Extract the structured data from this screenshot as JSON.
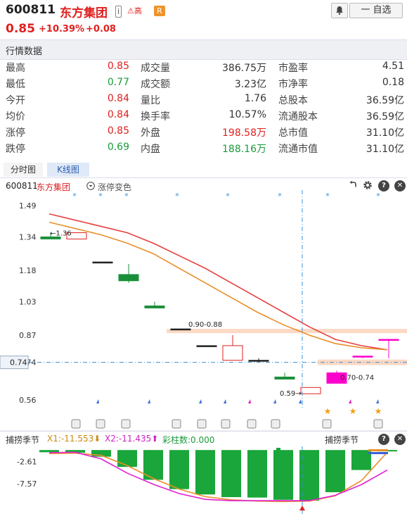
{
  "header": {
    "code": "600811",
    "name": "东方集团",
    "tag_info": "i",
    "tag_risk": "⚠高",
    "tag_r": "R",
    "price": "0.85",
    "change_pct": "+10.39%",
    "change": "+0.08",
    "bell_icon": "bell-icon",
    "watch_label": "一 自选"
  },
  "quote_section": {
    "title": "行情数据",
    "rows": [
      {
        "l1": "最高",
        "v1": "0.85",
        "l2": "成交量",
        "v2": "386.75万",
        "l3": "市盈率",
        "v3": "4.51"
      },
      {
        "l1": "最低",
        "v1": "0.77",
        "l2": "成交额",
        "v2": "3.23亿",
        "l3": "市净率",
        "v3": "0.18"
      },
      {
        "l1": "今开",
        "v1": "0.84",
        "l2": "量比",
        "v2": "1.76",
        "l3": "总股本",
        "v3": "36.59亿"
      },
      {
        "l1": "均价",
        "v1": "0.84",
        "l2": "换手率",
        "v2": "10.57%",
        "l3": "流通股本",
        "v3": "36.59亿"
      },
      {
        "l1": "涨停",
        "v1": "0.85",
        "l2": "外盘",
        "v2": "198.58万",
        "l3": "总市值",
        "v3": "31.10亿"
      },
      {
        "l1": "跌停",
        "v1": "0.69",
        "l2": "内盘",
        "v2": "188.16万",
        "l3": "流通市值",
        "v3": "31.10亿"
      }
    ]
  },
  "tabs": {
    "timeshare": "分时图",
    "kline": "K线图"
  },
  "kline_bar": {
    "code": "600811",
    "name": "东方集团",
    "mode": "涨停变色"
  },
  "chart_data": [
    {
      "type": "candlestick",
      "y_ticks": [
        "1.49",
        "1.34",
        "1.18",
        "1.03",
        "0.87",
        "0.74",
        "0.56"
      ],
      "ylim": [
        0.52,
        1.53
      ],
      "candles": [
        {
          "open": 1.34,
          "close": 1.33,
          "high": 1.36,
          "low": 1.33,
          "color": "green"
        },
        {
          "open": 1.33,
          "close": 1.36,
          "high": 1.36,
          "low": 1.33,
          "color": "red"
        },
        {
          "open": 1.22,
          "close": 1.22,
          "high": 1.22,
          "low": 1.22,
          "color": "black"
        },
        {
          "open": 1.16,
          "close": 1.13,
          "high": 1.21,
          "low": 1.12,
          "color": "green"
        },
        {
          "open": 1.01,
          "close": 1.0,
          "high": 1.03,
          "low": 1.0,
          "color": "green"
        },
        {
          "open": 0.9,
          "close": 0.9,
          "high": 0.9,
          "low": 0.9,
          "color": "black"
        },
        {
          "open": 0.82,
          "close": 0.82,
          "high": 0.82,
          "low": 0.82,
          "color": "black"
        },
        {
          "open": 0.75,
          "close": 0.82,
          "high": 0.87,
          "low": 0.75,
          "color": "red"
        },
        {
          "open": 0.75,
          "close": 0.75,
          "high": 0.76,
          "low": 0.74,
          "color": "black"
        },
        {
          "open": 0.67,
          "close": 0.66,
          "high": 0.69,
          "low": 0.66,
          "color": "green"
        },
        {
          "open": 0.59,
          "close": 0.62,
          "high": 0.62,
          "low": 0.59,
          "color": "red"
        },
        {
          "open": 0.64,
          "close": 0.69,
          "high": 0.7,
          "low": 0.64,
          "color": "magenta"
        },
        {
          "open": 0.77,
          "close": 0.77,
          "high": 0.77,
          "low": 0.76,
          "color": "magenta"
        },
        {
          "open": 0.85,
          "close": 0.85,
          "high": 0.85,
          "low": 0.76,
          "color": "magenta"
        }
      ],
      "ma_red": [
        1.45,
        1.42,
        1.39,
        1.36,
        1.31,
        1.25,
        1.19,
        1.12,
        1.05,
        0.98,
        0.91,
        0.85,
        0.82,
        0.8
      ],
      "ma_orange": [
        1.41,
        1.38,
        1.35,
        1.31,
        1.26,
        1.19,
        1.12,
        1.05,
        0.98,
        0.92,
        0.87,
        0.83,
        0.81,
        0.8
      ],
      "annotations": {
        "high_label": "1.36",
        "zone_high": "0.90-0.88",
        "zone_low": "0.70-0.74",
        "low_label": "0.59",
        "crosshair_label": "0.74"
      }
    },
    {
      "type": "bar",
      "title": "捕捞季节",
      "x1_label": "X1:-11.553",
      "x2_label": "X2:-11.435",
      "bar_count_label": "彩柱数:0.000",
      "y_ticks": [
        "-2.61",
        "-7.57"
      ],
      "ylim": [
        -12.5,
        0.5
      ],
      "bars": [
        -0.5,
        -0.6,
        -1.5,
        -3.8,
        -6.7,
        -8.8,
        -10.0,
        -10.6,
        -10.7,
        -11.2,
        -11.4,
        -9.5,
        -4.5,
        -0.3
      ],
      "x1": [
        -0.8,
        -0.7,
        -1.2,
        -3.5,
        -6.4,
        -8.8,
        -10.5,
        -11.2,
        -11.5,
        -11.6,
        -11.5,
        -10.3,
        -6.9,
        -0.5
      ],
      "x2": [
        -0.6,
        -0.5,
        -2.0,
        -5.2,
        -7.7,
        -9.8,
        -11.1,
        -11.4,
        -11.4,
        -11.4,
        -11.4,
        -10.2,
        -7.8,
        -4.5
      ]
    }
  ],
  "chart_toolbar": {
    "undo_icon": "undo-icon",
    "settings_icon": "gear-icon",
    "help_icon": "help-icon",
    "close_icon": "close-icon"
  }
}
